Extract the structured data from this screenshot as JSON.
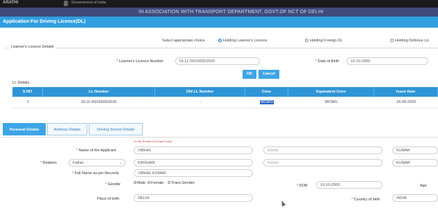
{
  "topbar": {
    "site": "ARATHI",
    "gov": "Government of India"
  },
  "association_banner": "IN ASSOCIATION WITH TRANSPORT DEPARTMENT, GOVT.OF NCT OF DELHI",
  "app_title": "Application For Driving Licence(DL)",
  "choice": {
    "label": "Select appropriate choice",
    "options": [
      {
        "label": "Holding Learner's Licence",
        "selected": true
      },
      {
        "label": "Holding Foreign DL",
        "selected": false
      },
      {
        "label": "Holding Defence Lic",
        "selected": false
      }
    ]
  },
  "learner_details": {
    "legend": "Learner's Licence Details",
    "ll_number_label": "Learner's Licence Number",
    "ll_number_value": "DL11 /0015925/2020",
    "dob_label": "Date of Birth",
    "dob_value": "10-10-2000",
    "ok_label": "OK",
    "cancel_label": "Cancel"
  },
  "ll_table": {
    "caption": "LL Details :",
    "headers": [
      "S.NO",
      "LL Number",
      "Old LL Number",
      "Covs",
      "Equivalent Covs",
      "Issue Date"
    ],
    "rows": [
      [
        "1",
        "DL11 /0015925/2020",
        "-",
        "MCWG",
        "MCWG",
        "16-09-2020"
      ]
    ]
  },
  "tabs": [
    {
      "label": "Personal Details",
      "active": true
    },
    {
      "label": "Address Details",
      "active": false
    },
    {
      "label": "Driving School Details",
      "active": false
    }
  ],
  "personal": {
    "note": "(To Be Printed On Smart Card)",
    "applicant_label": "Name of the Applicant",
    "first_name": "VIBHAL",
    "middle_placeholder": "Middle",
    "last_name": "KUMAR",
    "relation_label": "Relation",
    "relation_value": "Father",
    "relation_first": "KRISHAN",
    "relation_middle_placeholder": "Middle",
    "relation_last": "KUMAR",
    "fullname_label": "Full Name as per Records",
    "fullname_value": "VIBHAL KUMAR",
    "gender_label": "Gender",
    "gender_options": [
      "Male",
      "Female",
      "Trans Gender"
    ],
    "dob_label": "DOB",
    "dob_value": "10-10-2000",
    "age_label": "Age",
    "place_label": "Place of birth",
    "place_value": "DELHI",
    "country_label": "Country of birth",
    "country_value": "INDIA"
  }
}
